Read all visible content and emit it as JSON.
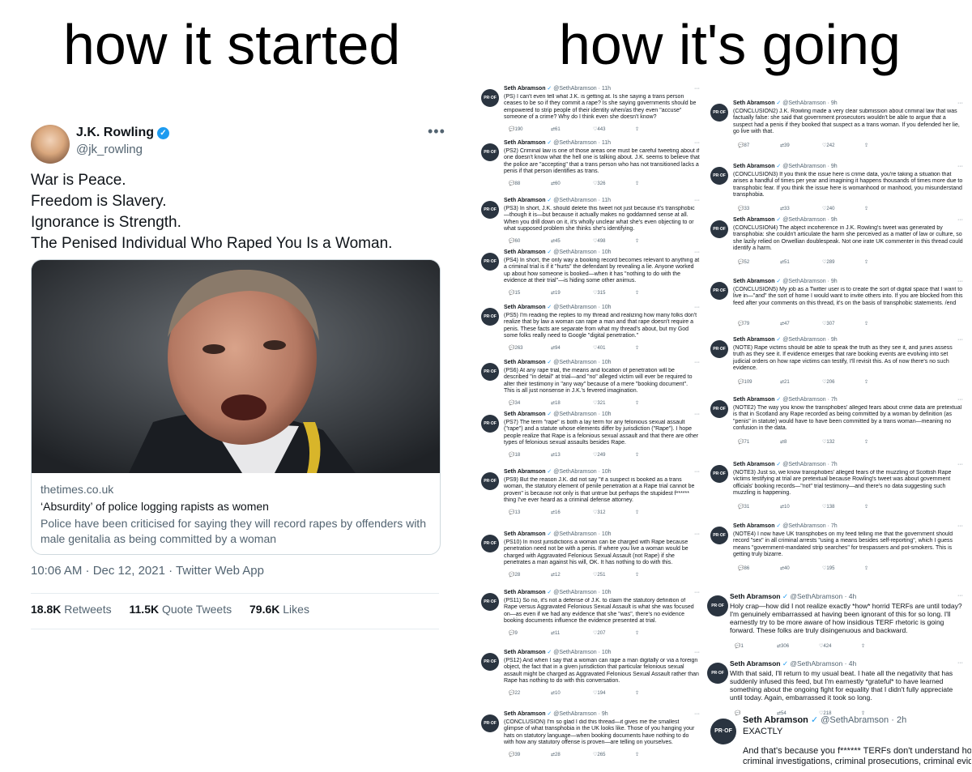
{
  "headings": {
    "left": "how it started",
    "right": "how it's going"
  },
  "left_tweet": {
    "author_name": "J.K. Rowling",
    "author_handle": "@jk_rowling",
    "lines": [
      "War is Peace.",
      "Freedom is Slavery.",
      "Ignorance is Strength.",
      "The Penised Individual Who Raped You Is a Woman."
    ],
    "card": {
      "domain": "thetimes.co.uk",
      "title": "‘Absurdity’ of police logging rapists as women",
      "description": "Police have been criticised for saying they will record rapes by offenders with male genitalia as being committed by a woman"
    },
    "timestamp": "10:06 AM · Dec 12, 2021 · Twitter Web App",
    "stats": {
      "retweets_count": "18.8K",
      "retweets_label": "Retweets",
      "quotes_count": "11.5K",
      "quotes_label": "Quote Tweets",
      "likes_count": "79.6K",
      "likes_label": "Likes"
    }
  },
  "thread": {
    "author_name": "Seth Abramson",
    "author_handle": "@SethAbramson",
    "avatar_text": "PR·OF",
    "left_column": [
      {
        "time": "· 11h",
        "text": "(PS) I can't even tell what J.K. is getting at. Is she saying a trans person ceases to be so if they commit a rape? Is she saying governments should be empowered to strip people of their identity when/as they even \"accuse\" someone of a crime? Why do I think even she doesn't know?",
        "replies": "190",
        "retweets": "61",
        "likes": "443"
      },
      {
        "time": "· 11h",
        "text": "(PS2) Criminal law is one of those areas one must be careful tweeting about if one doesn't know what the hell one is talking about. J.K. seems to believe that the police are \"accepting\" that a trans person who has not transitioned lacks a penis if that person identifies as trans.",
        "replies": "88",
        "retweets": "60",
        "likes": "326"
      },
      {
        "time": "· 11h",
        "text": "(PS3) In short, J.K. should delete this tweet not just because it's transphobic—though it is—but because it actually makes no goddamned sense at all. When you drill down on it, it's wholly unclear what she's even objecting to or what supposed problem she thinks she's identifying.",
        "replies": "60",
        "retweets": "45",
        "likes": "498"
      },
      {
        "time": "· 10h",
        "text": "(PS4) In short, the only way a booking record becomes relevant to anything at a criminal trial is if it \"hurts\" the defendant by revealing a lie. Anyone worked up about how someone is booked—when it has \"nothing to do with the evidence at their trial\"—is hiding some other animus.",
        "replies": "15",
        "retweets": "19",
        "likes": "315"
      },
      {
        "time": "· 10h",
        "text": "(PS5) I'm reading the replies to my thread and realizing how many folks don't realize that by law a woman can rape a man and that rape doesn't require a penis. These facts are separate from what my thread's about, but my God some folks really need to Google \"digital penetration.\"",
        "replies": "263",
        "retweets": "94",
        "likes": "401"
      },
      {
        "time": "· 10h",
        "text": "(PS6) At any rape trial, the means and location of penetration will be described \"in detail\" at trial—and \"no\" alleged victim will ever be required to alter their testimony in \"any way\" because of a mere \"booking document\". This is all just nonsense in J.K.'s fevered imagination.",
        "replies": "34",
        "retweets": "18",
        "likes": "321"
      },
      {
        "time": "· 10h",
        "text": "(PS7) The term \"rape\" is both a lay term for any felonious sexual assault (\"rape\") and a statute whose elements differ by jurisdiction (\"Rape\"). I hope people realize that Rape is a felonious sexual assault and that there are other types of felonious sexual assaults besides Rape.",
        "replies": "18",
        "retweets": "13",
        "likes": "249"
      },
      {
        "time": "· 10h",
        "text": "(PS9) But the reason J.K. did not say \"if a suspect is booked as a trans woman, the statutory element of penile penetration at a Rape trial cannot be proven\" is because not only is that untrue but perhaps the stupidest f****** thing I've ever heard as a criminal defense attorney.",
        "replies": "13",
        "retweets": "16",
        "likes": "312"
      },
      {
        "time": "· 10h",
        "text": "(PS10) In most jurisdictions a woman can be charged with Rape because penetration need not be with a penis. If where you live a woman would be charged with Aggravated Felonious Sexual Assault (not Rape) if she penetrates a man against his will, OK. It has nothing to do with this.",
        "replies": "28",
        "retweets": "12",
        "likes": "251"
      },
      {
        "time": "· 10h",
        "text": "(PS11) So no, it's not a defense of J.K. to claim the statutory definition of Rape versus Aggravated Felonious Sexual Assault is what she was focused on—as even if we had any evidence that she \"was\", there's no evidence booking documents influence the evidence presented at trial.",
        "replies": "9",
        "retweets": "11",
        "likes": "207"
      },
      {
        "time": "· 10h",
        "text": "(PS12) And when I say that a woman can rape a man digitally or via a foreign object, the fact that in a given jurisdiction that particular felonious sexual assault might be charged as Aggravated Felonious Sexual Assault rather than Rape has nothing to do with this conversation.",
        "replies": "22",
        "retweets": "10",
        "likes": "194"
      },
      {
        "time": "· 9h",
        "text": "(CONCLUSION) I'm so glad I did this thread—it gives me the smallest glimpse of what transphobia in the UK looks like. Those of you hanging your hats on statutory language—when booking documents have nothing to do with how any statutory offense is proven—are telling on yourselves.",
        "replies": "39",
        "retweets": "28",
        "likes": "265"
      }
    ],
    "right_column": [
      {
        "time": "· 9h",
        "text": "(CONCLUSION2) J.K. Rowling made a very clear submission about criminal law that was factually false: she said that government prosecutors wouldn't be able to argue that a suspect had a penis if they booked that suspect as a trans woman. If you defended her lie, go live with that.",
        "replies": "87",
        "retweets": "39",
        "likes": "242"
      },
      {
        "time": "· 9h",
        "text": "(CONCLUSION3) If you think the issue here is crime data, you're taking a situation that arises a handful of times per year and imagining it happens thousands of times more due to transphobic fear. If you think the issue here is womanhood or manhood, you misunderstand transphobia.",
        "replies": "33",
        "retweets": "33",
        "likes": "240"
      },
      {
        "time": "· 9h",
        "text": "(CONCLUSION4) The abject incoherence in J.K. Rowling's tweet was generated by transphobia: she couldn't articulate the harm she perceived as a matter of law or culture, so she lazily relied on Orwellian doublespeak. Not one irate UK commenter in this thread could identify a harm.",
        "replies": "52",
        "retweets": "51",
        "likes": "289"
      },
      {
        "time": "· 9h",
        "text": "(CONCLUSION5) My job as a Twitter user is to create the sort of digital space that I want to live in—\"and\" the sort of home I would want to invite others into. If you are blocked from this feed after your comments on this thread, it's on the basis of transphobic statements. /end",
        "replies": "79",
        "retweets": "47",
        "likes": "307"
      },
      {
        "time": "· 9h",
        "text": "(NOTE) Rape victims should be able to speak the truth as they see it, and juries assess truth as they see it. If evidence emerges that rare booking events are evolving into set judicial orders on how rape victims can testify, I'll revisit this. As of now there's no such evidence.",
        "replies": "109",
        "retweets": "21",
        "likes": "206"
      },
      {
        "time": "· 7h",
        "text": "(NOTE2) The way you know the transphobes' alleged fears about crime data are pretextual is that in Scotland any Rape recorded as being committed by a woman by definition (as \"penis\" in statute) would have to have been committed by a trans woman—meaning no confusion in the data.",
        "replies": "71",
        "retweets": "8",
        "likes": "132"
      },
      {
        "time": "· 7h",
        "text": "(NOTE3) Just so, we know transphobes' alleged fears of the muzzling of Scottish Rape victims testifying at trial are pretextual because Rowling's tweet was about government officials' booking records—\"not\" trial testimony—and there's no data suggesting such muzzling is happening.",
        "replies": "31",
        "retweets": "10",
        "likes": "138"
      },
      {
        "time": "· 7h",
        "text": "(NOTE4) I now have UK transphobes on my feed telling me that the government should record \"sex\" in all criminal arrests \"using a means besides self-reporting\", which I guess means \"government-mandated strip searches\" for trespassers and pot-smokers. This is getting truly bizarre.",
        "replies": "86",
        "retweets": "40",
        "likes": "195"
      }
    ],
    "big_column": [
      {
        "time": "· 4h",
        "text": "Holy crap—how did I not realize exactly *how* horrid TERFs are until today? I'm genuinely embarrassed at having been ignorant of this for so long. I'll earnestly try to be more aware of how insidious TERF rhetoric is going forward. These folks are truly disingenuous and backward.",
        "replies": "1",
        "retweets": "306",
        "likes": "424"
      },
      {
        "time": "· 4h",
        "text": "With that said, I'll return to my usual beat. I hate all the negativity that has suddenly infused this feed, but I'm earnestly *grateful* to have learned something about the ongoing fight for equality that I didn't fully appreciate until today. Again, embarrassed it took so long.",
        "replies": "",
        "retweets": "54",
        "likes": "218"
      }
    ],
    "final_tweet": {
      "time": "· 2h",
      "line1": "EXACTLY",
      "line2": "And that's because you f****** TERFs don't understand how crim",
      "line3": "criminal investigations, criminal prosecutions, criminal evidence"
    }
  },
  "icons": {
    "reply": "reply-icon",
    "retweet": "retweet-icon",
    "like": "heart-icon",
    "share": "share-icon",
    "verified": "verified-icon",
    "more": "more-icon"
  },
  "colors": {
    "verified": "#1d9bf0",
    "secondary_text": "#536471",
    "border": "#cfd9de"
  }
}
